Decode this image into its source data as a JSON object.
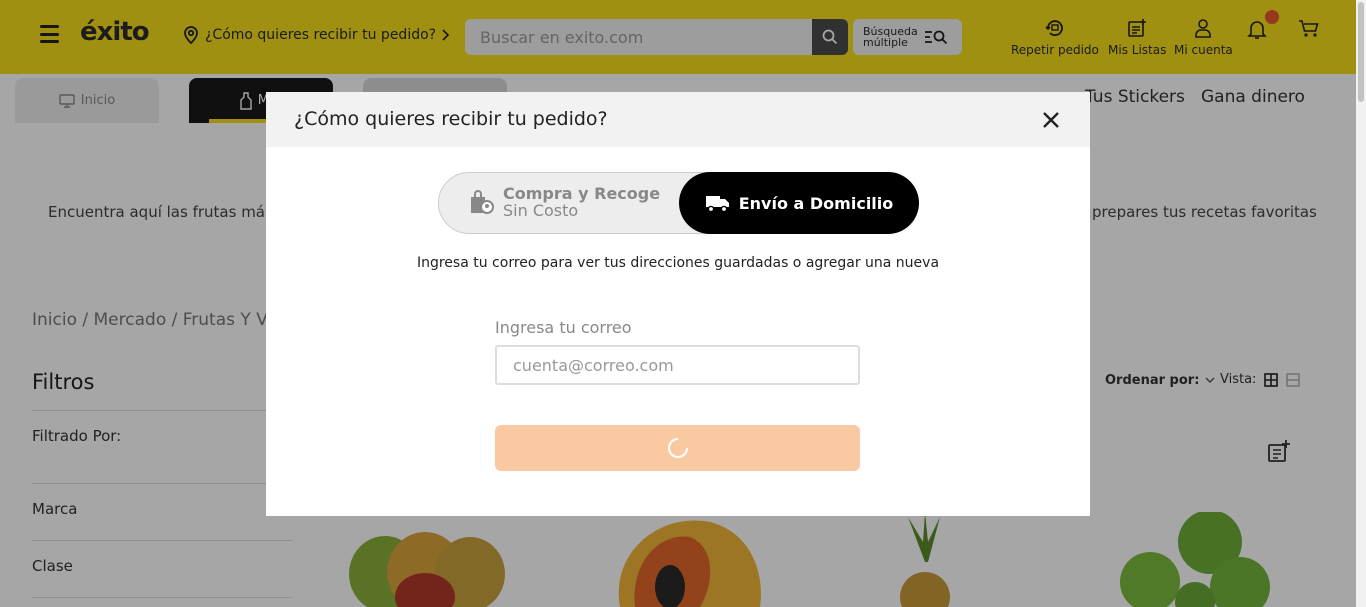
{
  "header": {
    "logo": "éxito",
    "location_prompt": "¿Cómo quieres recibir tu pedido?",
    "search_placeholder": "Buscar en exito.com",
    "multi_search": [
      "Búsqueda",
      "múltiple"
    ],
    "icons": [
      {
        "label": "Repetir pedido",
        "icon": "repeat-order-icon"
      },
      {
        "label": "Mis Listas",
        "icon": "list-icon"
      },
      {
        "label": "Mi cuenta",
        "icon": "user-icon"
      }
    ],
    "bell_icon": "bell-icon",
    "cart_icon": "cart-icon",
    "badge_color": "#e4572e",
    "accent": "#f5dd1b"
  },
  "nav": {
    "tabs": [
      {
        "label": "Inicio",
        "icon": "monitor-icon"
      },
      {
        "label": "Mer",
        "icon": "bottle-icon"
      }
    ],
    "links": [
      "Tus Stickers",
      "Gana dinero"
    ]
  },
  "page": {
    "desc_left": "Encuentra aquí las frutas más",
    "desc_right": "prepares tus recetas favoritas",
    "breadcrumb": "Inicio / Mercado / Frutas Y Ve",
    "filters_title": "Filtros",
    "filtered_by": "Filtrado Por:",
    "filter_items": [
      "Marca",
      "Clase"
    ],
    "sort_label": "Ordenar por:",
    "view_label": "Vista:"
  },
  "modal": {
    "title": "¿Cómo quieres recibir tu pedido?",
    "option_pickup": {
      "line1": "Compra y Recoge",
      "line2": "Sin Costo"
    },
    "option_home": "Envío a Domicilio",
    "info": "Ingresa tu correo para ver tus direcciones guardadas o agregar una nueva",
    "email_label": "Ingresa tu correo",
    "email_placeholder": "cuenta@correo.com",
    "button_color": "#f9c9a2"
  }
}
